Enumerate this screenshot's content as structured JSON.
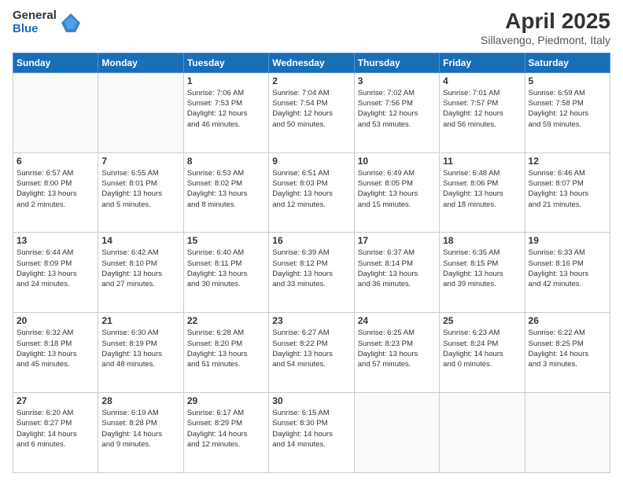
{
  "logo": {
    "general": "General",
    "blue": "Blue"
  },
  "title": "April 2025",
  "subtitle": "Sillavengo, Piedmont, Italy",
  "weekdays": [
    "Sunday",
    "Monday",
    "Tuesday",
    "Wednesday",
    "Thursday",
    "Friday",
    "Saturday"
  ],
  "weeks": [
    [
      {
        "day": "",
        "info": ""
      },
      {
        "day": "",
        "info": ""
      },
      {
        "day": "1",
        "info": "Sunrise: 7:06 AM\nSunset: 7:53 PM\nDaylight: 12 hours\nand 46 minutes."
      },
      {
        "day": "2",
        "info": "Sunrise: 7:04 AM\nSunset: 7:54 PM\nDaylight: 12 hours\nand 50 minutes."
      },
      {
        "day": "3",
        "info": "Sunrise: 7:02 AM\nSunset: 7:56 PM\nDaylight: 12 hours\nand 53 minutes."
      },
      {
        "day": "4",
        "info": "Sunrise: 7:01 AM\nSunset: 7:57 PM\nDaylight: 12 hours\nand 56 minutes."
      },
      {
        "day": "5",
        "info": "Sunrise: 6:59 AM\nSunset: 7:58 PM\nDaylight: 12 hours\nand 59 minutes."
      }
    ],
    [
      {
        "day": "6",
        "info": "Sunrise: 6:57 AM\nSunset: 8:00 PM\nDaylight: 13 hours\nand 2 minutes."
      },
      {
        "day": "7",
        "info": "Sunrise: 6:55 AM\nSunset: 8:01 PM\nDaylight: 13 hours\nand 5 minutes."
      },
      {
        "day": "8",
        "info": "Sunrise: 6:53 AM\nSunset: 8:02 PM\nDaylight: 13 hours\nand 8 minutes."
      },
      {
        "day": "9",
        "info": "Sunrise: 6:51 AM\nSunset: 8:03 PM\nDaylight: 13 hours\nand 12 minutes."
      },
      {
        "day": "10",
        "info": "Sunrise: 6:49 AM\nSunset: 8:05 PM\nDaylight: 13 hours\nand 15 minutes."
      },
      {
        "day": "11",
        "info": "Sunrise: 6:48 AM\nSunset: 8:06 PM\nDaylight: 13 hours\nand 18 minutes."
      },
      {
        "day": "12",
        "info": "Sunrise: 6:46 AM\nSunset: 8:07 PM\nDaylight: 13 hours\nand 21 minutes."
      }
    ],
    [
      {
        "day": "13",
        "info": "Sunrise: 6:44 AM\nSunset: 8:09 PM\nDaylight: 13 hours\nand 24 minutes."
      },
      {
        "day": "14",
        "info": "Sunrise: 6:42 AM\nSunset: 8:10 PM\nDaylight: 13 hours\nand 27 minutes."
      },
      {
        "day": "15",
        "info": "Sunrise: 6:40 AM\nSunset: 8:11 PM\nDaylight: 13 hours\nand 30 minutes."
      },
      {
        "day": "16",
        "info": "Sunrise: 6:39 AM\nSunset: 8:12 PM\nDaylight: 13 hours\nand 33 minutes."
      },
      {
        "day": "17",
        "info": "Sunrise: 6:37 AM\nSunset: 8:14 PM\nDaylight: 13 hours\nand 36 minutes."
      },
      {
        "day": "18",
        "info": "Sunrise: 6:35 AM\nSunset: 8:15 PM\nDaylight: 13 hours\nand 39 minutes."
      },
      {
        "day": "19",
        "info": "Sunrise: 6:33 AM\nSunset: 8:16 PM\nDaylight: 13 hours\nand 42 minutes."
      }
    ],
    [
      {
        "day": "20",
        "info": "Sunrise: 6:32 AM\nSunset: 8:18 PM\nDaylight: 13 hours\nand 45 minutes."
      },
      {
        "day": "21",
        "info": "Sunrise: 6:30 AM\nSunset: 8:19 PM\nDaylight: 13 hours\nand 48 minutes."
      },
      {
        "day": "22",
        "info": "Sunrise: 6:28 AM\nSunset: 8:20 PM\nDaylight: 13 hours\nand 51 minutes."
      },
      {
        "day": "23",
        "info": "Sunrise: 6:27 AM\nSunset: 8:22 PM\nDaylight: 13 hours\nand 54 minutes."
      },
      {
        "day": "24",
        "info": "Sunrise: 6:25 AM\nSunset: 8:23 PM\nDaylight: 13 hours\nand 57 minutes."
      },
      {
        "day": "25",
        "info": "Sunrise: 6:23 AM\nSunset: 8:24 PM\nDaylight: 14 hours\nand 0 minutes."
      },
      {
        "day": "26",
        "info": "Sunrise: 6:22 AM\nSunset: 8:25 PM\nDaylight: 14 hours\nand 3 minutes."
      }
    ],
    [
      {
        "day": "27",
        "info": "Sunrise: 6:20 AM\nSunset: 8:27 PM\nDaylight: 14 hours\nand 6 minutes."
      },
      {
        "day": "28",
        "info": "Sunrise: 6:19 AM\nSunset: 8:28 PM\nDaylight: 14 hours\nand 9 minutes."
      },
      {
        "day": "29",
        "info": "Sunrise: 6:17 AM\nSunset: 8:29 PM\nDaylight: 14 hours\nand 12 minutes."
      },
      {
        "day": "30",
        "info": "Sunrise: 6:15 AM\nSunset: 8:30 PM\nDaylight: 14 hours\nand 14 minutes."
      },
      {
        "day": "",
        "info": ""
      },
      {
        "day": "",
        "info": ""
      },
      {
        "day": "",
        "info": ""
      }
    ]
  ]
}
